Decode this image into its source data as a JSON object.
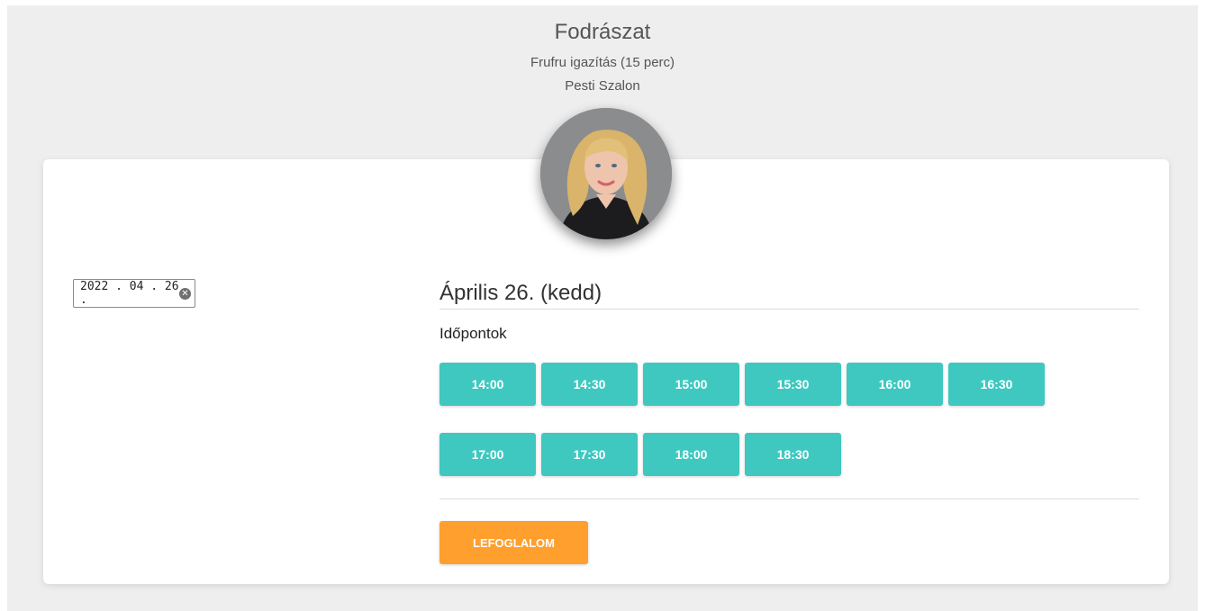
{
  "header": {
    "title": "Fodrászat",
    "service": "Frufru igazítás (15 perc)",
    "salon": "Pesti Szalon"
  },
  "date_picker": {
    "value": "2022 . 04 . 26 .",
    "clear_icon": "clear-circle-icon"
  },
  "schedule": {
    "day_title": "Április 26. (kedd)",
    "slots_label": "Időpontok",
    "slots": [
      "14:00",
      "14:30",
      "15:00",
      "15:30",
      "16:00",
      "16:30",
      "17:00",
      "17:30",
      "18:00",
      "18:30"
    ]
  },
  "actions": {
    "book_label": "LEFOGLALOM"
  },
  "colors": {
    "slot": "#3ec8c0",
    "book": "#ff9f2e",
    "background": "#eeeeee"
  }
}
